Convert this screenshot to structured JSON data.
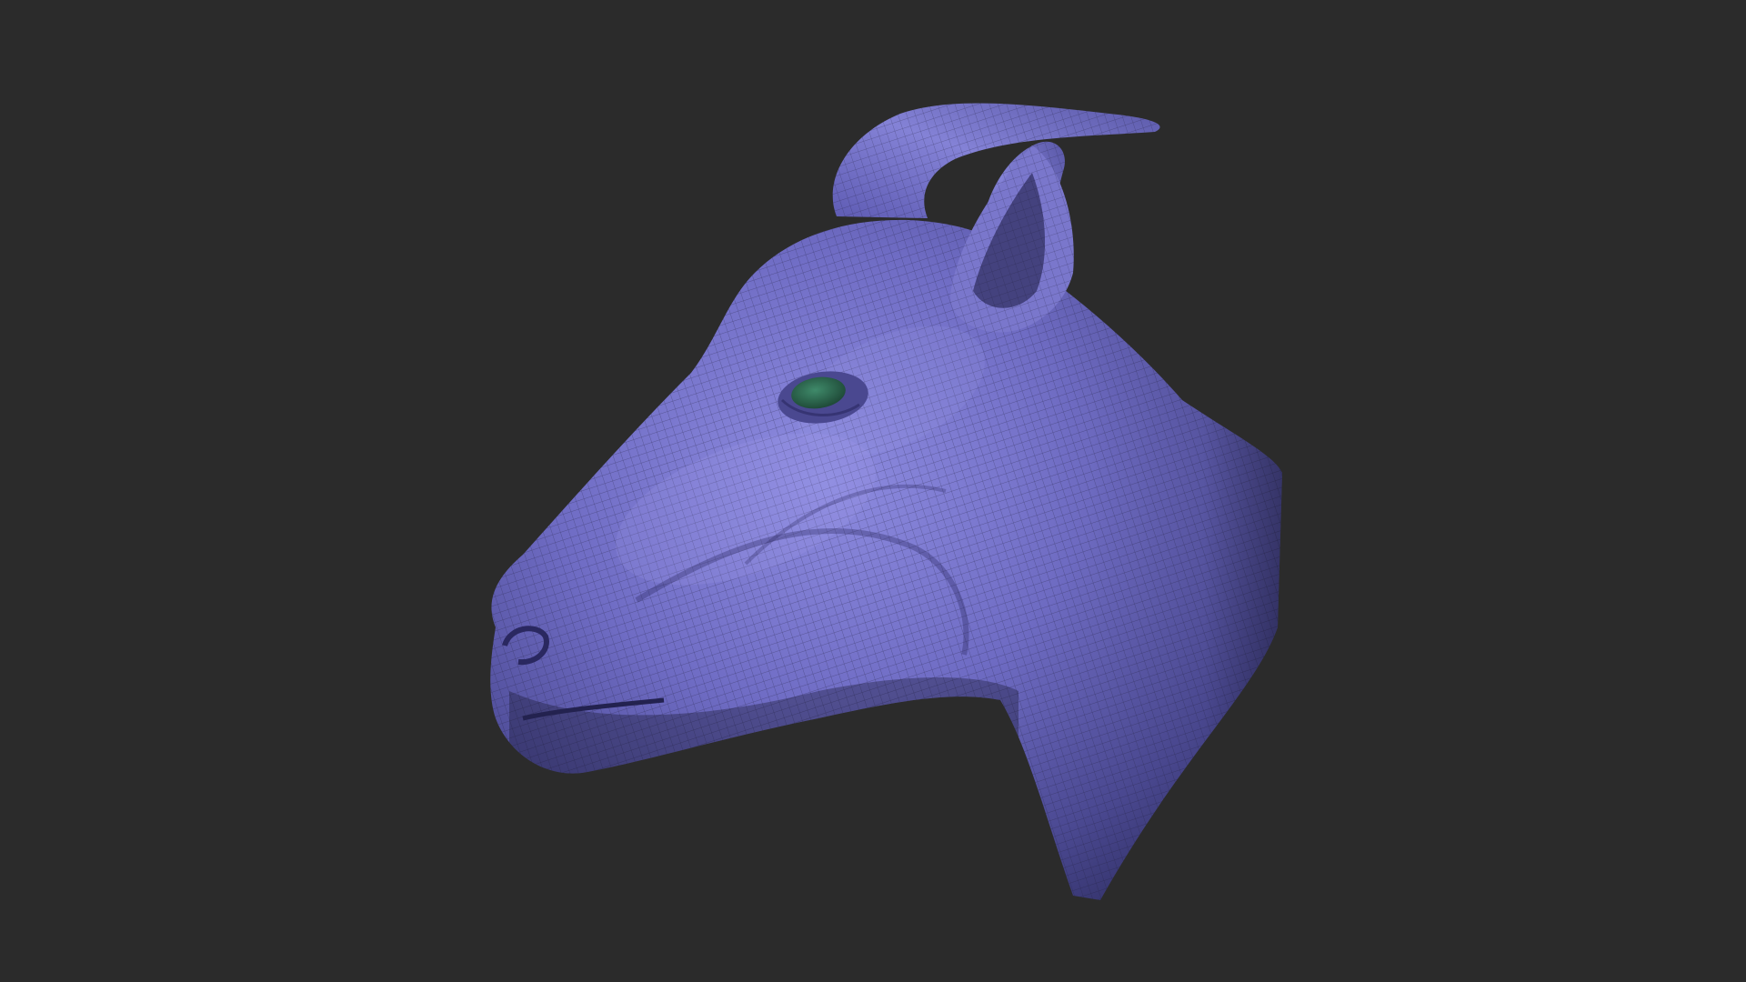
{
  "viewport": {
    "background_color": "#2b2b2b"
  },
  "model": {
    "subject": "goat head",
    "material_color": "#6f6cc4",
    "eye_color": "#2f6a52",
    "shading": "wireframe-quad-mesh"
  }
}
